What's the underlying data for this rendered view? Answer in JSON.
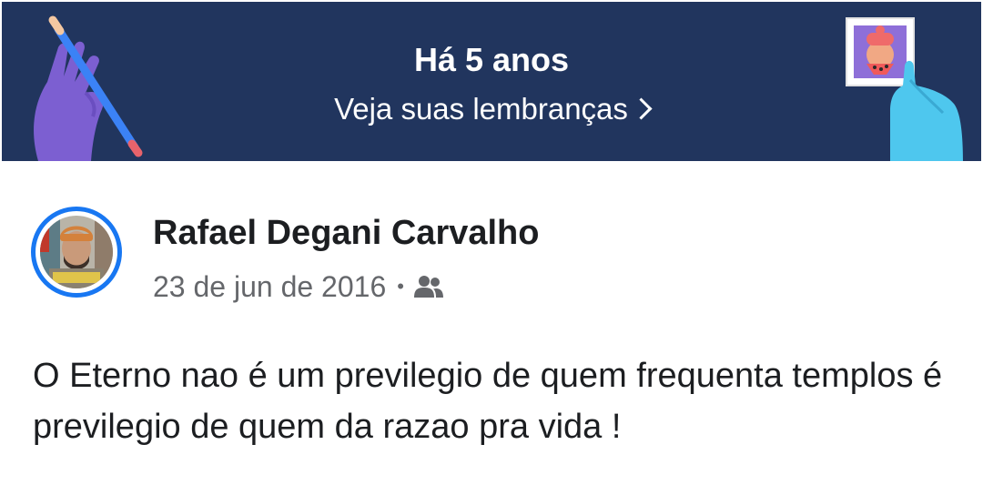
{
  "memories_banner": {
    "title": "Há 5 anos",
    "link_label": "Veja suas lembranças",
    "background_color": "#21355e",
    "link_icon": "chevron-right-icon"
  },
  "post": {
    "author_name": "Rafael Degani Carvalho",
    "date": "23 de jun de 2016",
    "separator": "•",
    "audience_icon": "friends-icon",
    "text": "O Eterno nao é um previlegio de quem frequenta templos é previlegio de quem da razao pra vida !",
    "avatar_ring_color": "#1877f2"
  }
}
